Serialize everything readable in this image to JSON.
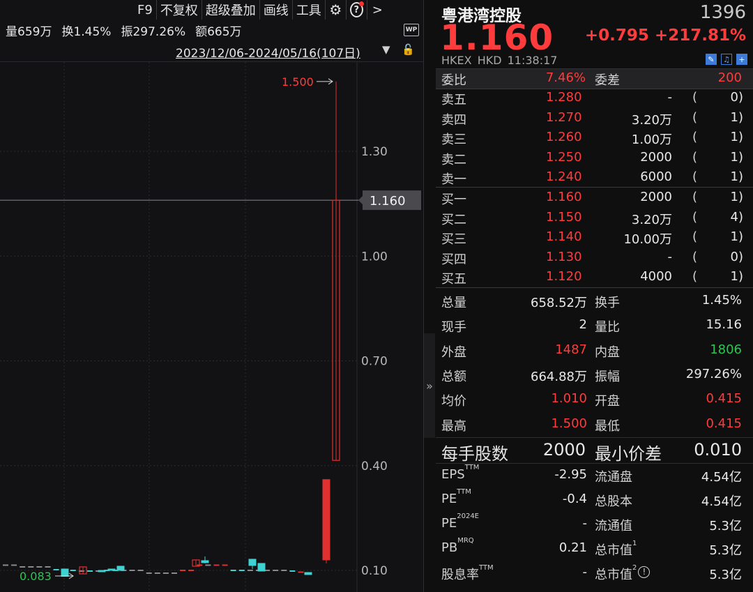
{
  "toolbar": {
    "f9": "F9",
    "adjust": "不复权",
    "overlay": "超级叠加",
    "draw": "画线",
    "tools": "工具",
    "more": ">"
  },
  "stats": {
    "volume": "量659万",
    "turnover": "换1.45%",
    "amplitude": "振297.26%",
    "amount": "额665万"
  },
  "wp_label": "WP",
  "date_range": "2023/12/06-2024/05/16(107日)",
  "chart_data": {
    "type": "candlestick",
    "y_ticks": [
      1.3,
      1.0,
      0.7,
      0.4,
      0.1
    ],
    "y_tick_labels": [
      "1.30",
      "1.00",
      "0.70",
      "0.40",
      "0.10"
    ],
    "ylim": [
      0.08,
      1.55
    ],
    "current_price_label": "1.160",
    "current_price": 1.16,
    "high_marker_label": "1.500",
    "high_marker": 1.5,
    "low_marker_label": "0.083",
    "low_marker": 0.083,
    "flat_bars": [
      {
        "value": 0.115,
        "color": "gray"
      },
      {
        "value": 0.115,
        "color": "gray"
      },
      {
        "value": 0.11,
        "color": "gray"
      },
      {
        "value": 0.11,
        "color": "gray"
      },
      {
        "value": 0.11,
        "color": "gray"
      },
      {
        "value": 0.11,
        "color": "gray"
      },
      {
        "value": 0.102,
        "color": "cyan"
      },
      {
        "value": 0.1,
        "color": "cyan"
      },
      {
        "value": 0.1,
        "color": "cyan"
      },
      {
        "value": 0.098,
        "color": "gray"
      },
      {
        "value": 0.098,
        "color": "cyan"
      },
      {
        "value": 0.098,
        "color": "gray"
      },
      {
        "value": 0.1,
        "color": "cyan"
      },
      {
        "value": 0.1,
        "color": "cyan"
      },
      {
        "value": 0.1,
        "color": "gray"
      },
      {
        "value": 0.1,
        "color": "gray"
      },
      {
        "value": 0.1,
        "color": "gray"
      },
      {
        "value": 0.092,
        "color": "gray"
      },
      {
        "value": 0.092,
        "color": "gray"
      },
      {
        "value": 0.092,
        "color": "gray"
      },
      {
        "value": 0.092,
        "color": "gray"
      },
      {
        "value": 0.1,
        "color": "red"
      },
      {
        "value": 0.1,
        "color": "red"
      },
      {
        "value": 0.115,
        "color": "red"
      },
      {
        "value": 0.115,
        "color": "gray"
      },
      {
        "value": 0.115,
        "color": "red"
      },
      {
        "value": 0.115,
        "color": "red"
      },
      {
        "value": 0.1,
        "color": "cyan"
      },
      {
        "value": 0.1,
        "color": "cyan"
      },
      {
        "value": 0.1,
        "color": "gray"
      },
      {
        "value": 0.1,
        "color": "gray"
      },
      {
        "value": 0.1,
        "color": "gray"
      },
      {
        "value": 0.1,
        "color": "gray"
      },
      {
        "value": 0.1,
        "color": "gray"
      },
      {
        "value": 0.098,
        "color": "cyan"
      },
      {
        "value": 0.095,
        "color": "red"
      }
    ],
    "candles": [
      {
        "open": 0.104,
        "close": 0.083,
        "high": 0.104,
        "low": 0.083,
        "color": "cyan"
      },
      {
        "open": 0.09,
        "close": 0.11,
        "high": 0.11,
        "low": 0.09,
        "color": "red_hollow"
      },
      {
        "open": 0.098,
        "close": 0.1,
        "high": 0.1,
        "low": 0.098,
        "color": "cyan"
      },
      {
        "open": 0.1,
        "close": 0.104,
        "high": 0.104,
        "low": 0.1,
        "color": "cyan"
      },
      {
        "open": 0.112,
        "close": 0.1,
        "high": 0.112,
        "low": 0.1,
        "color": "cyan"
      },
      {
        "open": 0.112,
        "close": 0.13,
        "high": 0.13,
        "low": 0.112,
        "color": "red_hollow"
      },
      {
        "open": 0.128,
        "close": 0.122,
        "high": 0.14,
        "low": 0.12,
        "color": "cyan"
      },
      {
        "open": 0.132,
        "close": 0.114,
        "high": 0.132,
        "low": 0.104,
        "color": "cyan"
      },
      {
        "open": 0.12,
        "close": 0.098,
        "high": 0.12,
        "low": 0.098,
        "color": "cyan"
      },
      {
        "open": 0.094,
        "close": 0.088,
        "high": 0.094,
        "low": 0.088,
        "color": "cyan"
      },
      {
        "open": 0.13,
        "close": 0.36,
        "high": 0.36,
        "low": 0.12,
        "color": "red_filled"
      },
      {
        "open": 0.415,
        "close": 1.16,
        "high": 1.5,
        "low": 0.415,
        "color": "red_hollow"
      }
    ]
  },
  "quote": {
    "name": "粤港湾控股",
    "code": "1396",
    "price": "1.160",
    "change": "+0.795",
    "change_pct": "+217.81%",
    "exchange": "HKEX",
    "currency": "HKD",
    "time": "11:38:17"
  },
  "webi": {
    "label1": "委比",
    "value1": "7.46%",
    "label2": "委差",
    "value2": "200"
  },
  "asks": [
    {
      "label": "卖五",
      "price": "1.280",
      "vol": "-",
      "lp": "(",
      "count": "0)"
    },
    {
      "label": "卖四",
      "price": "1.270",
      "vol": "3.20万",
      "lp": "(",
      "count": "1)"
    },
    {
      "label": "卖三",
      "price": "1.260",
      "vol": "1.00万",
      "lp": "(",
      "count": "1)"
    },
    {
      "label": "卖二",
      "price": "1.250",
      "vol": "2000",
      "lp": "(",
      "count": "1)"
    },
    {
      "label": "卖一",
      "price": "1.240",
      "vol": "6000",
      "lp": "(",
      "count": "1)"
    }
  ],
  "bids": [
    {
      "label": "买一",
      "price": "1.160",
      "vol": "2000",
      "lp": "(",
      "count": "1)"
    },
    {
      "label": "买二",
      "price": "1.150",
      "vol": "3.20万",
      "lp": "(",
      "count": "4)"
    },
    {
      "label": "买三",
      "price": "1.140",
      "vol": "10.00万",
      "lp": "(",
      "count": "1)"
    },
    {
      "label": "买四",
      "price": "1.130",
      "vol": "-",
      "lp": "(",
      "count": "0)"
    },
    {
      "label": "买五",
      "price": "1.120",
      "vol": "4000",
      "lp": "(",
      "count": "1)"
    }
  ],
  "stats_table": [
    {
      "l1": "总量",
      "v1": "658.52万",
      "l2": "换手",
      "v2": "1.45%"
    },
    {
      "l1": "现手",
      "v1": "2",
      "l2": "量比",
      "v2": "15.16"
    },
    {
      "l1": "外盘",
      "v1": "1487",
      "l2": "内盘",
      "v2": "1806"
    },
    {
      "l1": "总额",
      "v1": "664.88万",
      "l2": "振幅",
      "v2": "297.26%"
    },
    {
      "l1": "均价",
      "v1": "1.010",
      "l2": "开盘",
      "v2": "0.415"
    },
    {
      "l1": "最高",
      "v1": "1.500",
      "l2": "最低",
      "v2": "0.415"
    }
  ],
  "lot": {
    "label1": "每手股数",
    "value1": "2000",
    "label2": "最小价差",
    "value2": "0.010"
  },
  "fundamentals": {
    "eps_label": "EPS",
    "eps_sup": "TTM",
    "eps_value": "-2.95",
    "float_label": "流通盘",
    "float_value": "4.54亿",
    "pe_label": "PE",
    "pe_sup": "TTM",
    "pe_value": "-0.4",
    "total_shares_label": "总股本",
    "total_shares_value": "4.54亿",
    "pe2_label": "PE",
    "pe2_sup": "2024E",
    "pe2_value": "-",
    "float_mv_label": "流通值",
    "float_mv_value": "5.3亿",
    "pb_label": "PB",
    "pb_sup": "MRQ",
    "pb_value": "0.21",
    "mv_label": "总市值",
    "mv_sup": "1",
    "mv_value": "5.3亿",
    "div_label": "股息率",
    "div_sup": "TTM",
    "div_value": "-",
    "mv2_label": "总市值",
    "mv2_sup": "2",
    "mv2_value": "5.3亿"
  },
  "colors": {
    "up": "#ff3b3b",
    "down": "#28c850",
    "candle_down": "#3ed2d2"
  }
}
